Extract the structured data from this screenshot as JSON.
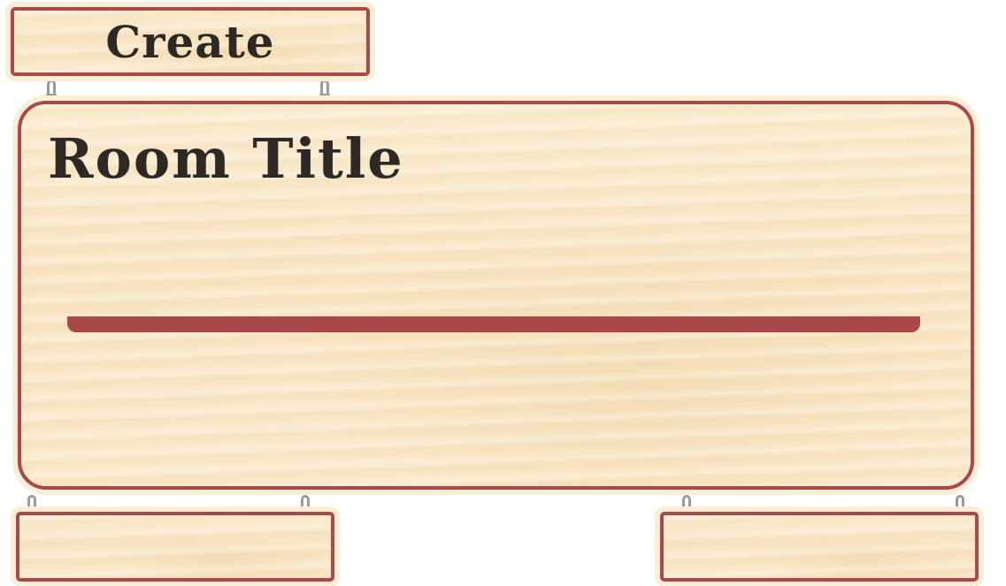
{
  "create": {
    "label": "Create"
  },
  "room": {
    "title_label": "Room Title",
    "title_value": "",
    "title_placeholder": ""
  },
  "bottom": {
    "left_label": "",
    "right_label": ""
  },
  "colors": {
    "accent": "#a9494a",
    "wood": "#f8e4c3",
    "text": "#2d2a26",
    "hook": "#9e9a95"
  },
  "icons": {
    "hook": "hanging-hook-icon"
  }
}
